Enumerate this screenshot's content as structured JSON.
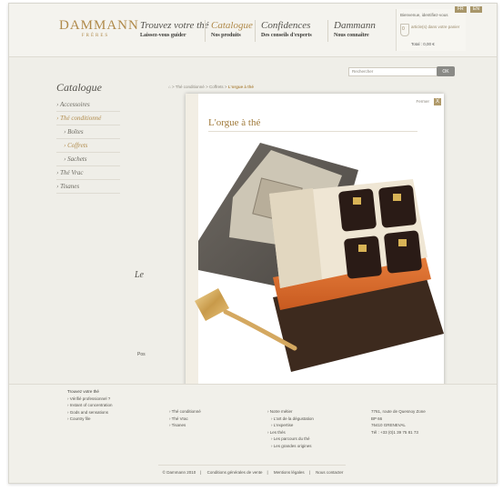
{
  "header": {
    "logo": {
      "name": "DAMMANN",
      "sub": "FRÈRES"
    },
    "nav": [
      {
        "title": "Trouvez votre thé",
        "subtitle": "Laissez-vous guider"
      },
      {
        "title": "Catalogue",
        "subtitle": "Nos produits"
      },
      {
        "title": "Confidences",
        "subtitle": "Des conseils d'experts"
      },
      {
        "title": "Dammann",
        "subtitle": "Nous connaître"
      }
    ],
    "account": {
      "welcome": "Bienvenue, identifiez-vous",
      "cart": "article(s) dans votre panier",
      "cart_count": "0",
      "total": "Total : 0,00 €"
    },
    "languages": [
      "FR",
      "EN"
    ]
  },
  "search": {
    "placeholder": "Rechercher",
    "button": "OK"
  },
  "page": {
    "title": "Catalogue",
    "breadcrumb": [
      "Thé conditionné",
      "Coffrets"
    ],
    "breadcrumb_current": "L'orgue à thé"
  },
  "sidebar": [
    {
      "label": "Accessoires",
      "level": 0
    },
    {
      "label": "Thé conditionné",
      "level": 0
    },
    {
      "label": "Boîtes",
      "level": 1
    },
    {
      "label": "Coffrets",
      "level": 1
    },
    {
      "label": "Sachets",
      "level": 1
    },
    {
      "label": "Thé Vrac",
      "level": 0
    },
    {
      "label": "Tisanes",
      "level": 0
    }
  ],
  "background_fragments": {
    "le": "Le",
    "pos": "Pos"
  },
  "modal": {
    "title": "L'orgue à thé",
    "close_label": "Fermer",
    "close_icon": "X"
  },
  "footer": {
    "col1": {
      "heading": "Trouvez votre thé",
      "items": [
        "Vérifié professionnel ?",
        "Instant of concentration",
        "Gods and sensations",
        "Country file"
      ]
    },
    "col2": {
      "items": [
        "Thé conditionné",
        "Thé Vrac",
        "Tisanes"
      ]
    },
    "col3": {
      "items": [
        "Notre métier",
        "L'art de la dégustation",
        "L'expertise",
        "Les thés",
        "Les parcours du thé",
        "Les grandes origines"
      ]
    },
    "address": [
      "7761, route de Quesnoy Zone",
      "BP 66",
      "76410 GRENEVAL",
      "Tél : +33 (0)1 39 75 81 73"
    ],
    "bottom": [
      "© Dammann 2010",
      "Conditions générales de vente",
      "Mentions légales",
      "Nous contacter"
    ]
  }
}
